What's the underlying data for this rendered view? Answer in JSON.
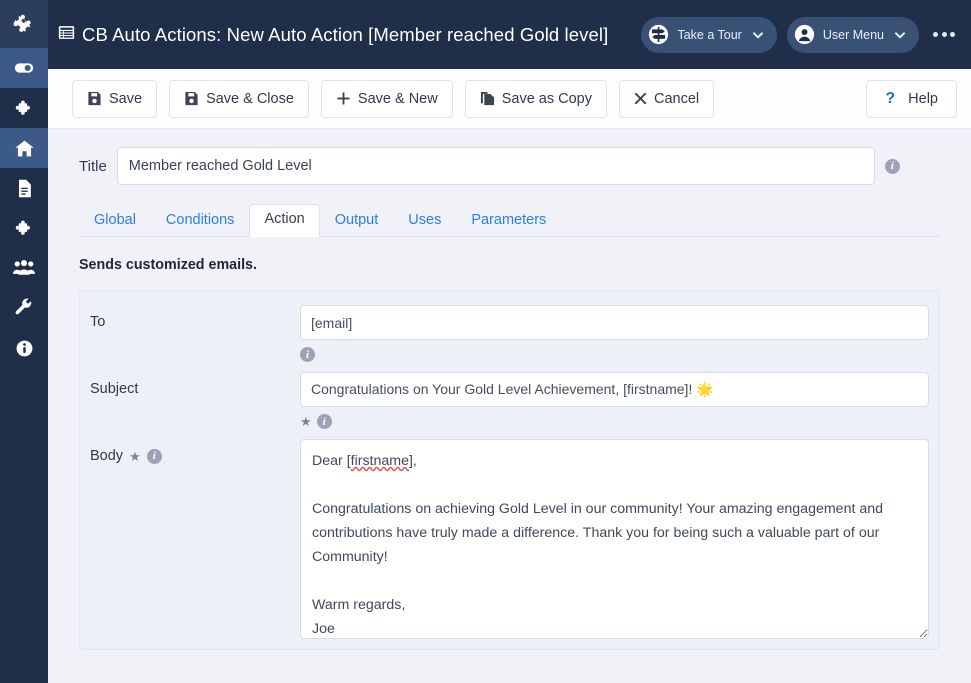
{
  "sidebar": {
    "logo_icon": "joomla-logo-icon",
    "items": [
      {
        "name": "toggle",
        "icon": "toggle-icon",
        "active": true
      },
      {
        "name": "extensions",
        "icon": "puzzle-icon",
        "active": false
      },
      {
        "name": "home",
        "icon": "home-icon",
        "active": true
      },
      {
        "name": "content",
        "icon": "document-icon",
        "active": false
      },
      {
        "name": "components",
        "icon": "puzzle-icon",
        "active": false
      },
      {
        "name": "users",
        "icon": "users-icon",
        "active": false
      },
      {
        "name": "tools",
        "icon": "wrench-icon",
        "active": false
      },
      {
        "name": "info",
        "icon": "info-circle-icon",
        "active": false
      }
    ]
  },
  "header": {
    "icon": "list-view-icon",
    "title": "CB Auto Actions: New Auto Action [Member reached Gold level]",
    "tour_button": {
      "label": "Take a Tour",
      "icon": "signpost-icon",
      "chevron": "chevron-down-icon"
    },
    "user_menu": {
      "label": "User Menu",
      "icon": "user-circle-icon",
      "chevron": "chevron-down-icon"
    },
    "overflow_icon": "kebab-menu-icon",
    "bg_color": "#1f2f4a"
  },
  "toolbar": {
    "save_label": "Save",
    "save_close_label": "Save & Close",
    "save_new_label": "Save & New",
    "save_copy_label": "Save as Copy",
    "cancel_label": "Cancel",
    "help_label": "Help",
    "help_symbol": "?"
  },
  "form": {
    "title_label": "Title",
    "title_value": "Member reached Gold Level",
    "title_placeholder": "",
    "title_info_icon": "info-icon"
  },
  "tabs": [
    {
      "label": "Global",
      "active": false
    },
    {
      "label": "Conditions",
      "active": false
    },
    {
      "label": "Action",
      "active": true
    },
    {
      "label": "Output",
      "active": false
    },
    {
      "label": "Uses",
      "active": false
    },
    {
      "label": "Parameters",
      "active": false
    }
  ],
  "action": {
    "description": "Sends customized emails.",
    "to": {
      "label": "To",
      "value": "[email]",
      "info_icon": "info-icon"
    },
    "subject": {
      "label": "Subject",
      "value": "Congratulations on Your Gold Level Achievement, [firstname]! 🌟",
      "star_icon": "star-icon",
      "info_icon": "info-icon"
    },
    "body": {
      "label": "Body",
      "star_icon": "star-icon",
      "info_icon": "info-icon",
      "line_greeting_prefix": "Dear [",
      "line_greeting_token": "firstname",
      "line_greeting_suffix": "],",
      "paragraph": "Congratulations on achieving Gold Level in our community! Your amazing engagement and contributions have truly made a difference. Thank you for being such a valuable part of our Community!",
      "signoff": "Warm regards,",
      "signature": "Joe",
      "resize_handle": "resize-grip-icon"
    }
  },
  "colors": {
    "header_bg": "#1f2f4a",
    "sidebar_bg": "#1f2f4a",
    "sidebar_active": "#3c5a87",
    "page_bg": "#f0f2f8",
    "link_blue": "#2b7de9",
    "panel_bg": "#eef0f8"
  }
}
